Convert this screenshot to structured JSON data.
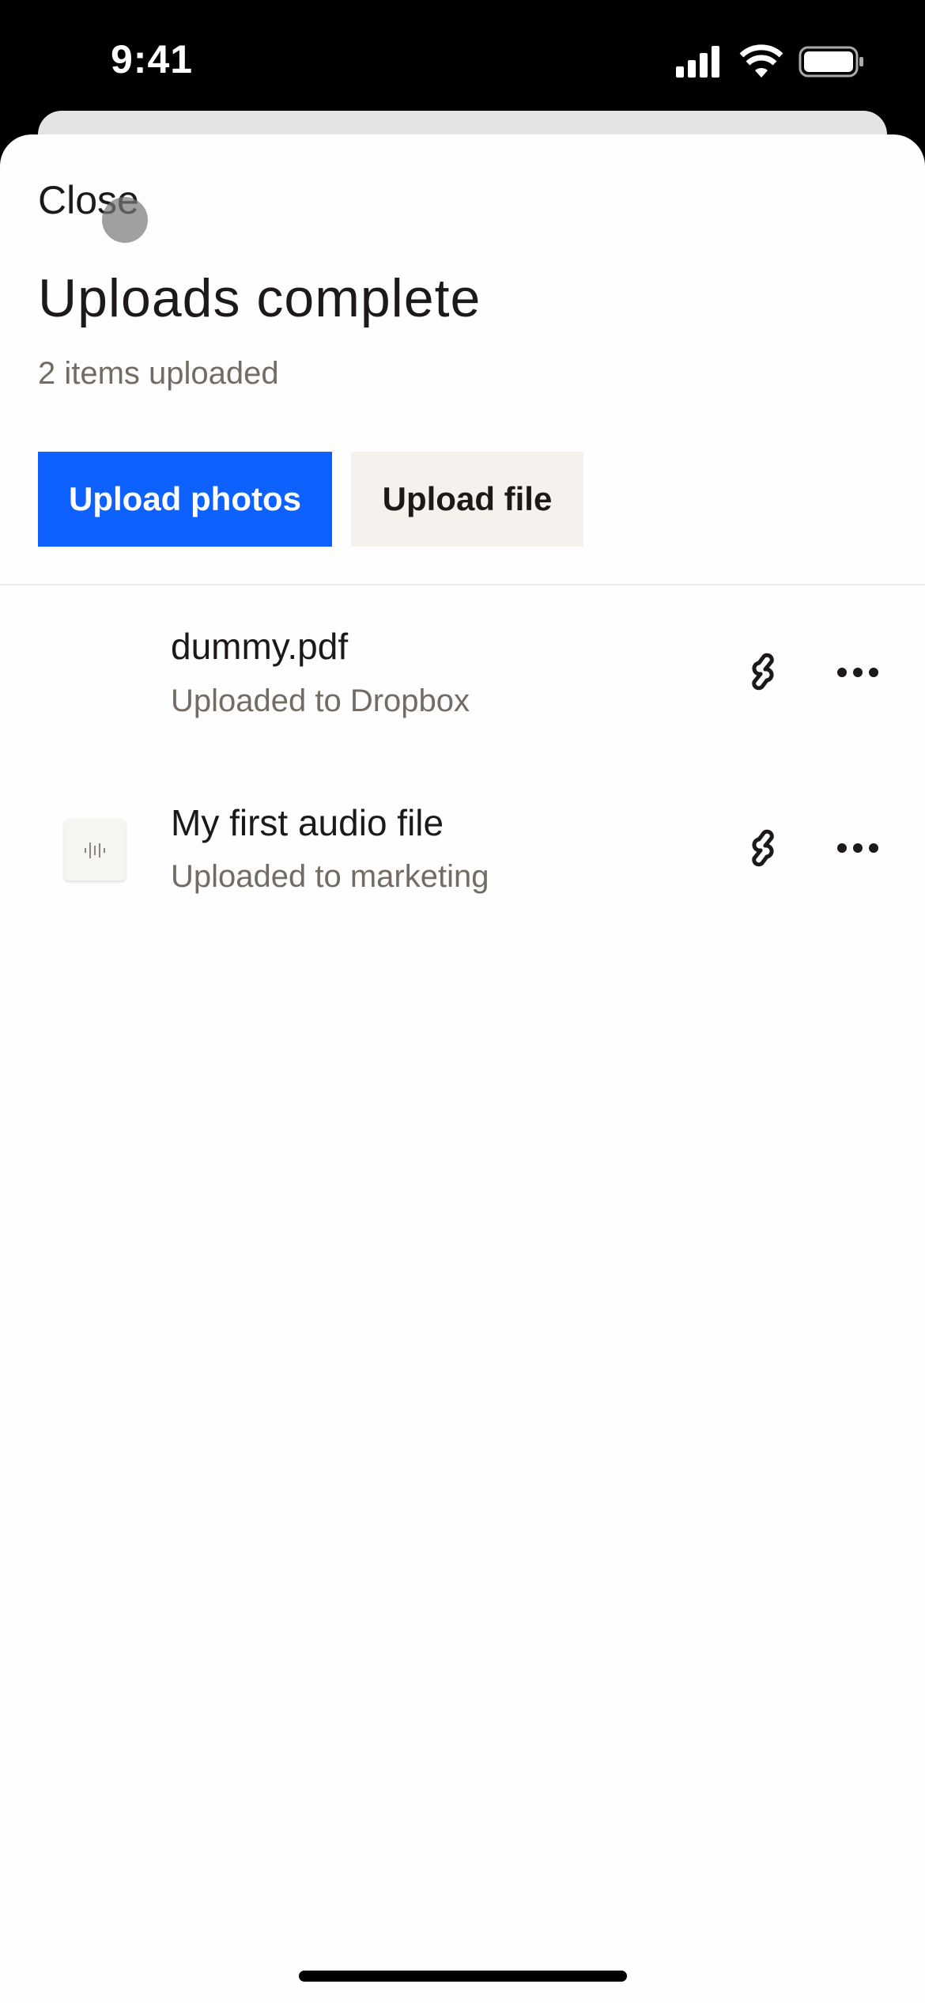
{
  "status_bar": {
    "time": "9:41"
  },
  "sheet": {
    "close_label": "Close",
    "title": "Uploads complete",
    "subtitle": "2 items uploaded",
    "buttons": {
      "upload_photos": "Upload photos",
      "upload_file": "Upload file"
    },
    "accent_color": "#0d61fe"
  },
  "uploads": [
    {
      "name": "dummy.pdf",
      "location": "Uploaded to Dropbox",
      "icon": "none"
    },
    {
      "name": "My first audio file",
      "location": "Uploaded to marketing",
      "icon": "audio-waveform-icon"
    }
  ]
}
